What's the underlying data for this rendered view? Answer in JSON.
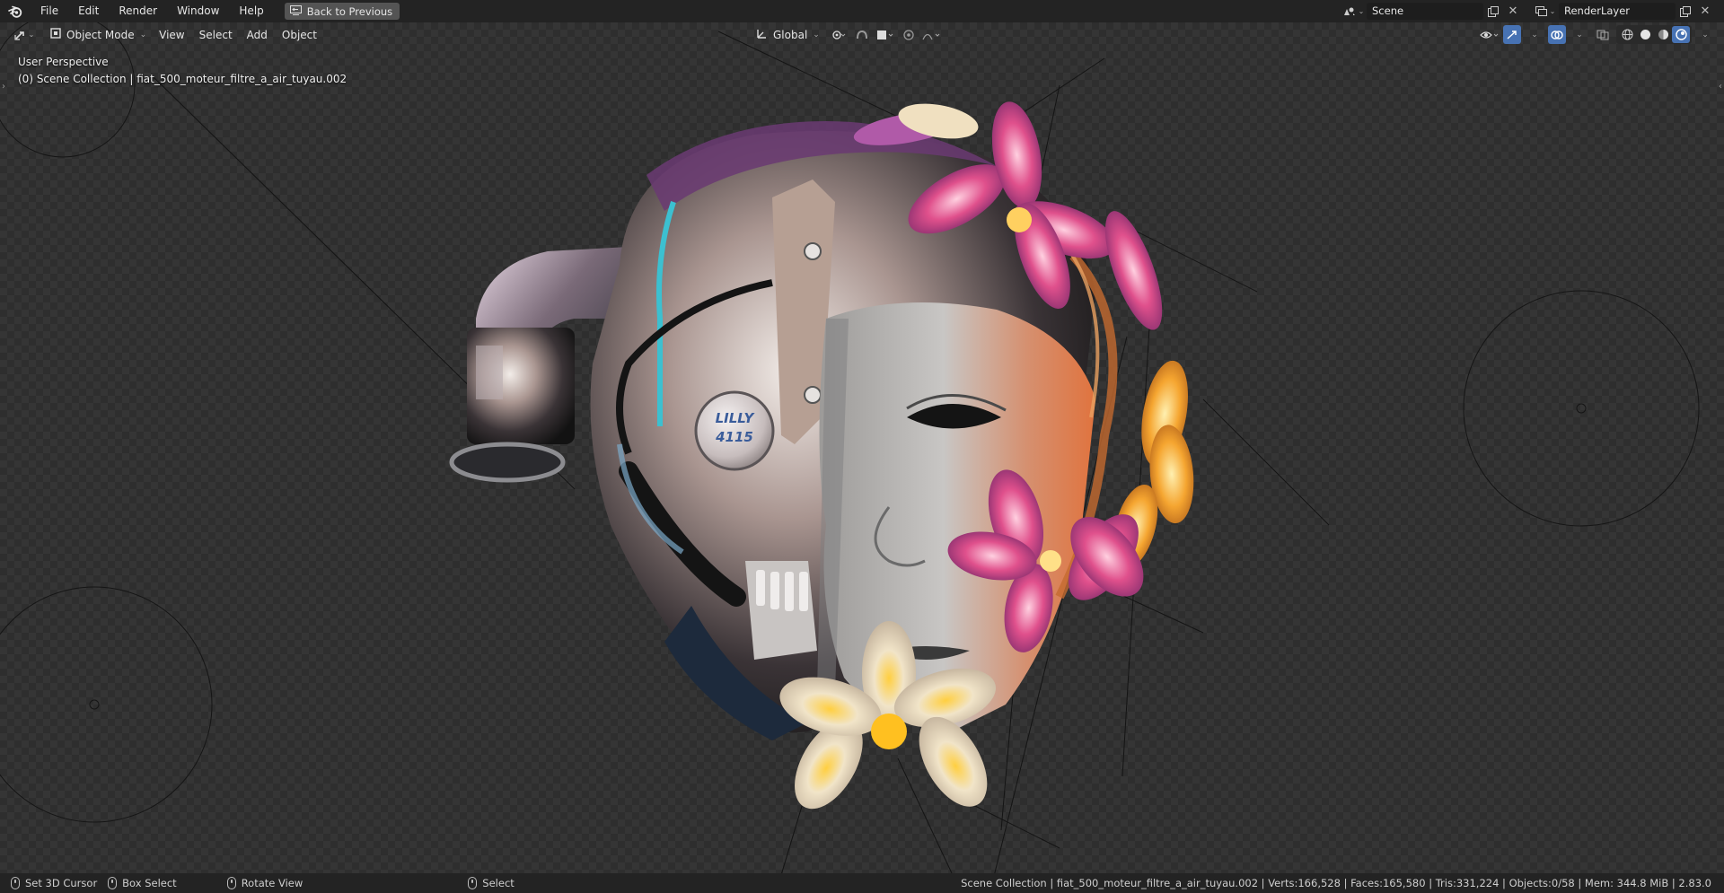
{
  "topbar": {
    "menus": [
      "File",
      "Edit",
      "Render",
      "Window",
      "Help"
    ],
    "back_button": "Back to Previous",
    "scene_name": "Scene",
    "render_layer_name": "RenderLayer"
  },
  "viewport_header": {
    "mode": "Object Mode",
    "menus": [
      "View",
      "Select",
      "Add",
      "Object"
    ],
    "transform_orientation": "Global"
  },
  "viewport": {
    "perspective_label": "User Perspective",
    "collection_label": "(0) Scene Collection | fiat_500_moteur_filtre_a_air_tuyau.002",
    "badge_text_line1": "LILLY",
    "badge_text_line2": "4115"
  },
  "statusbar": {
    "hint_cursor": "Set 3D Cursor",
    "hint_box": "Box Select",
    "hint_rotate": "Rotate View",
    "hint_select": "Select",
    "stats": "Scene Collection | fiat_500_moteur_filtre_a_air_tuyau.002 | Verts:166,528 | Faces:165,580 | Tris:331,224 | Objects:0/58 | Mem: 344.8 MiB | 2.83.0"
  },
  "colors": {
    "accent": "#4772b3",
    "button": "#545454",
    "header": "#232323"
  },
  "icons": {
    "logo": "blender-logo-icon",
    "editor": "viewport-editor-icon",
    "mode": "object-mode-icon",
    "orientation": "transform-orientation-icon",
    "pivot": "pivot-point-icon",
    "snap": "snap-icon",
    "proportional": "proportional-edit-icon",
    "visibility": "object-visibility-icon",
    "gizmo": "gizmo-icon",
    "overlay": "overlay-icon",
    "xray": "xray-icon",
    "shading_wire": "wireframe-shading-icon",
    "shading_solid": "solid-shading-icon",
    "shading_material": "material-shading-icon",
    "shading_rendered": "rendered-shading-icon"
  }
}
